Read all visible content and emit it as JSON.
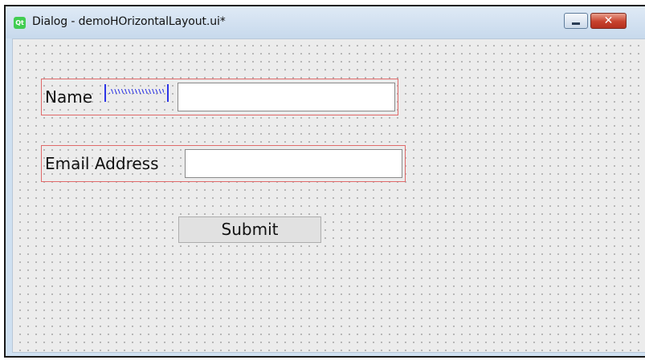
{
  "window": {
    "title": "Dialog - demoHOrizontalLayout.ui*",
    "app_icon_text": "Qt",
    "close_glyph": "✕"
  },
  "form": {
    "name_label": "Name",
    "name_value": "",
    "email_label": "Email Address",
    "email_value": "",
    "submit_label": "Submit"
  },
  "icons": {
    "app": "qt-logo-icon",
    "minimize": "minimize-icon",
    "close": "close-icon",
    "spacer": "horizontal-spacer-icon"
  },
  "colors": {
    "layout_border": "#e06a6a",
    "spacer": "#2d35e6",
    "close_button": "#c7412d",
    "canvas": "#ececec"
  }
}
